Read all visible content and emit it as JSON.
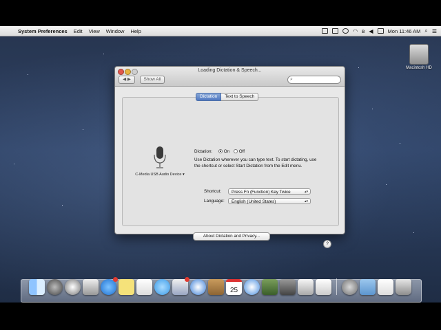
{
  "menubar": {
    "app": "System Preferences",
    "menus": [
      "Edit",
      "View",
      "Window",
      "Help"
    ],
    "clock": "Mon 11:46 AM"
  },
  "desktop": {
    "hd_label": "Macintosh HD"
  },
  "window": {
    "title": "Loading Dictation & Speech...",
    "show_all": "Show All",
    "search_placeholder": "",
    "tabs": [
      "Dictation",
      "Text to Speech"
    ],
    "selected_tab": "Dictation",
    "mic_device": "C-Media USB Audio Device",
    "dictation_label": "Dictation:",
    "on_label": "On",
    "off_label": "Off",
    "dictation_state": "On",
    "description": "Use Dictation wherever you can type text. To start dictating, use the shortcut or select Start Dictation from the Edit menu.",
    "shortcut_label": "Shortcut:",
    "shortcut_value": "Press Fn (Function) Key Twice",
    "language_label": "Language:",
    "language_value": "English (United States)",
    "about_button": "About Dictation and Privacy...",
    "help": "?"
  },
  "dock": {
    "calendar_day": "25",
    "items": [
      "finder",
      "launchpad",
      "mission-control",
      "app-store",
      "stickies",
      "notes",
      "messages",
      "mail",
      "safari",
      "contacts",
      "calendar",
      "itunes",
      "photo",
      "facetime",
      "preview",
      "textedit",
      "downloads",
      "documents",
      "trash"
    ]
  },
  "colors": {
    "selected_tab": "#4f78c1",
    "badge": "#e13a2f"
  }
}
